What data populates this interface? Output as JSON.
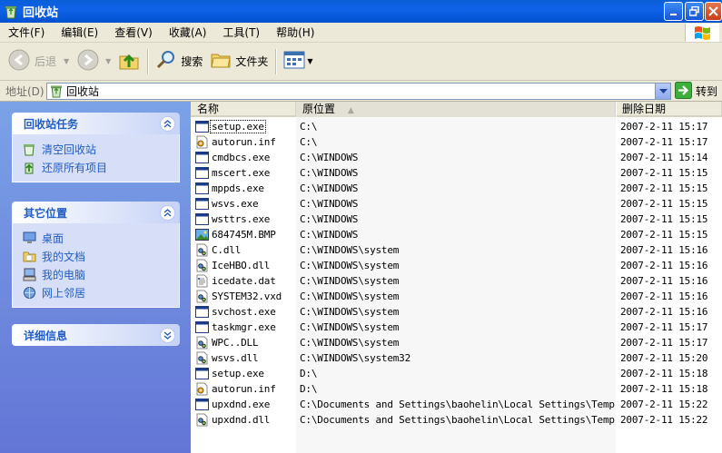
{
  "window": {
    "title": "回收站"
  },
  "menu": [
    "文件(F)",
    "编辑(E)",
    "查看(V)",
    "收藏(A)",
    "工具(T)",
    "帮助(H)"
  ],
  "toolbar": {
    "back": "后退",
    "search": "搜索",
    "folders": "文件夹"
  },
  "address": {
    "label": "地址(D)",
    "value": "回收站",
    "go": "转到"
  },
  "tasks": {
    "title": "回收站任务",
    "items": [
      {
        "label": "清空回收站",
        "icon": "empty-recycle-bin-icon"
      },
      {
        "label": "还原所有项目",
        "icon": "restore-all-icon"
      }
    ]
  },
  "places": {
    "title": "其它位置",
    "items": [
      {
        "label": "桌面",
        "icon": "desktop-icon"
      },
      {
        "label": "我的文档",
        "icon": "my-documents-icon"
      },
      {
        "label": "我的电脑",
        "icon": "my-computer-icon"
      },
      {
        "label": "网上邻居",
        "icon": "network-places-icon"
      }
    ]
  },
  "details": {
    "title": "详细信息"
  },
  "columns": {
    "name": "名称",
    "original": "原位置",
    "deleted": "删除日期"
  },
  "files": [
    {
      "name": "setup.exe",
      "orig": "C:\\",
      "date": "2007-2-11 15:17",
      "icon": "window-app"
    },
    {
      "name": "autorun.inf",
      "orig": "C:\\",
      "date": "2007-2-11 15:17",
      "icon": "settings-file"
    },
    {
      "name": "cmdbcs.exe",
      "orig": "C:\\WINDOWS",
      "date": "2007-2-11 15:14",
      "icon": "window-app"
    },
    {
      "name": "mscert.exe",
      "orig": "C:\\WINDOWS",
      "date": "2007-2-11 15:15",
      "icon": "window-app"
    },
    {
      "name": "mppds.exe",
      "orig": "C:\\WINDOWS",
      "date": "2007-2-11 15:15",
      "icon": "window-app"
    },
    {
      "name": "wsvs.exe",
      "orig": "C:\\WINDOWS",
      "date": "2007-2-11 15:15",
      "icon": "window-app"
    },
    {
      "name": "wsttrs.exe",
      "orig": "C:\\WINDOWS",
      "date": "2007-2-11 15:15",
      "icon": "window-app"
    },
    {
      "name": "684745M.BMP",
      "orig": "C:\\WINDOWS",
      "date": "2007-2-11 15:15",
      "icon": "image-file"
    },
    {
      "name": "C.dll",
      "orig": "C:\\WINDOWS\\system",
      "date": "2007-2-11 15:16",
      "icon": "dll-file"
    },
    {
      "name": "IceHBO.dll",
      "orig": "C:\\WINDOWS\\system",
      "date": "2007-2-11 15:16",
      "icon": "dll-file"
    },
    {
      "name": "icedate.dat",
      "orig": "C:\\WINDOWS\\system",
      "date": "2007-2-11 15:16",
      "icon": "data-file"
    },
    {
      "name": "SYSTEM32.vxd",
      "orig": "C:\\WINDOWS\\system",
      "date": "2007-2-11 15:16",
      "icon": "dll-file"
    },
    {
      "name": "svchost.exe",
      "orig": "C:\\WINDOWS\\system",
      "date": "2007-2-11 15:16",
      "icon": "window-app"
    },
    {
      "name": "taskmgr.exe",
      "orig": "C:\\WINDOWS\\system",
      "date": "2007-2-11 15:17",
      "icon": "window-app"
    },
    {
      "name": "WPC..DLL",
      "orig": "C:\\WINDOWS\\system",
      "date": "2007-2-11 15:17",
      "icon": "dll-file"
    },
    {
      "name": "wsvs.dll",
      "orig": "C:\\WINDOWS\\system32",
      "date": "2007-2-11 15:20",
      "icon": "dll-file"
    },
    {
      "name": "setup.exe",
      "orig": "D:\\",
      "date": "2007-2-11 15:18",
      "icon": "window-app"
    },
    {
      "name": "autorun.inf",
      "orig": "D:\\",
      "date": "2007-2-11 15:18",
      "icon": "settings-file"
    },
    {
      "name": "upxdnd.exe",
      "orig": "C:\\Documents and Settings\\baohelin\\Local Settings\\Temp",
      "date": "2007-2-11 15:22",
      "icon": "window-app"
    },
    {
      "name": "upxdnd.dll",
      "orig": "C:\\Documents and Settings\\baohelin\\Local Settings\\Temp",
      "date": "2007-2-11 15:22",
      "icon": "dll-file"
    }
  ],
  "colors": {
    "titlebar": "#0f62e8",
    "taskpane_top": "#7ba2e7",
    "link": "#215dc6",
    "chrome": "#ece9d8"
  }
}
